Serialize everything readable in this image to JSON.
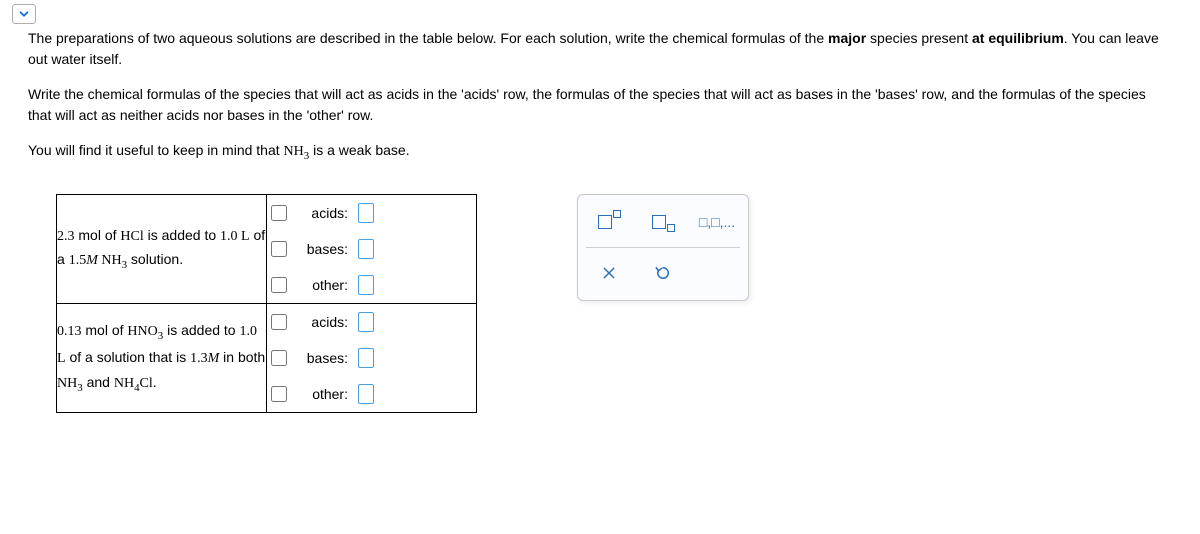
{
  "intro": {
    "p1_a": "The preparations of two aqueous solutions are described in the table below. For each solution, write the chemical formulas of the ",
    "p1_b": " species present ",
    "p1_c": ". You can leave out water itself.",
    "major": "major",
    "at_eq": "at equilibrium",
    "p2": "Write the chemical formulas of the species that will act as acids in the 'acids' row, the formulas of the species that will act as bases in the 'bases' row, and the formulas of the species that will act as neither acids nor bases in the 'other' row.",
    "p3_a": "You will find it useful to keep in mind that ",
    "p3_nh3": "NH",
    "p3_nh3_sub": "3",
    "p3_b": " is a weak base."
  },
  "labels": {
    "acids": "acids:",
    "bases": "bases:",
    "other": "other:"
  },
  "rows": [
    {
      "desc_parts": {
        "a": "2.3",
        "b": " mol of ",
        "c": "HCl",
        "d": " is added to ",
        "e": "1.0 L",
        "f": " of a ",
        "g": "1.5",
        "h": "M",
        "i": " NH",
        "i_sub": "3",
        "j": " solution."
      }
    },
    {
      "desc_parts": {
        "a": "0.13",
        "b": " mol of ",
        "c": "HNO",
        "c_sub": "3",
        "d": " is added to ",
        "e": "1.0 L",
        "f": " of a solution that is ",
        "g": "1.3",
        "h": "M",
        "i": " in both ",
        "j": "NH",
        "j_sub": "3",
        "k": " and ",
        "l": "NH",
        "l_sub": "4",
        "m": "Cl",
        "n": "."
      }
    }
  ],
  "tools": {
    "list_hint": "□,□,..."
  }
}
